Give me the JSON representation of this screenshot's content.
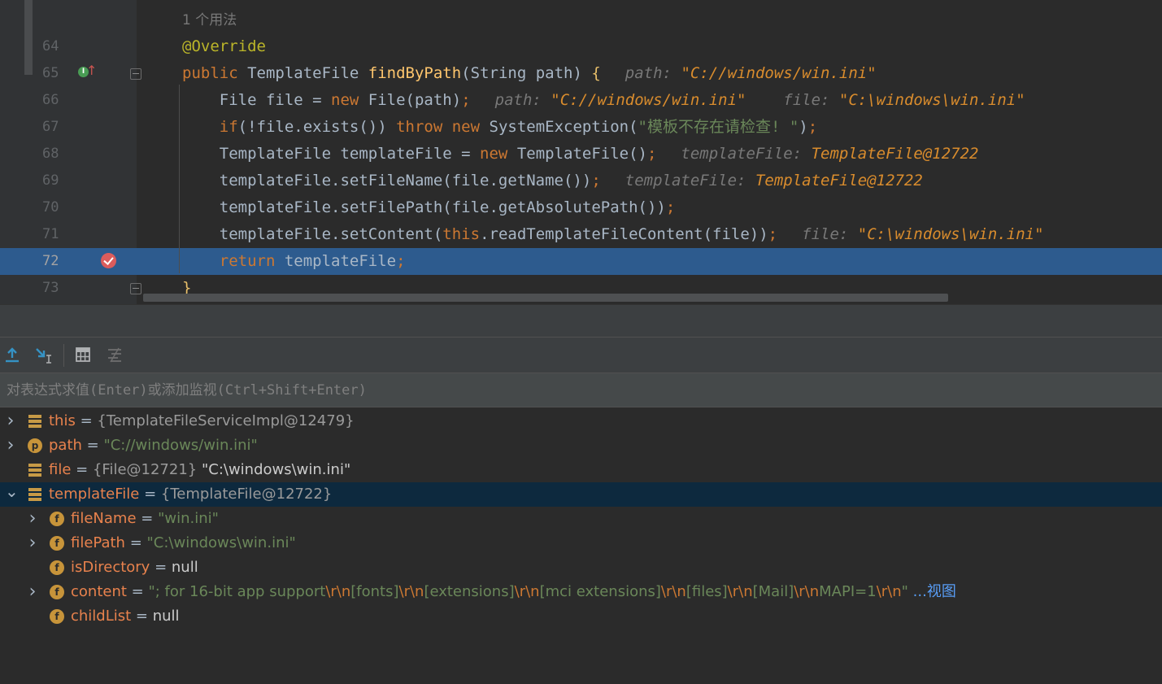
{
  "editor": {
    "usage_hint": "1 个用法",
    "lines": [
      {
        "num": "64",
        "parts": [
          {
            "t": "@Override",
            "c": "ann"
          }
        ]
      },
      {
        "num": "65",
        "parts": [
          {
            "t": "public ",
            "c": "kw"
          },
          {
            "t": "TemplateFile "
          },
          {
            "t": "findByPath",
            "c": "fn"
          },
          {
            "t": "(String path) "
          },
          {
            "t": "{",
            "c": "brk"
          }
        ],
        "hint": [
          {
            "t": "path: ",
            "c": "hint"
          },
          {
            "t": "\"C://windows/win.ini\"",
            "c": "hintv"
          }
        ]
      },
      {
        "num": "66",
        "parts": [
          {
            "t": "    File file = "
          },
          {
            "t": "new ",
            "c": "kw"
          },
          {
            "t": "File(path)"
          },
          {
            "t": ";",
            "c": "kw"
          }
        ],
        "hint": [
          {
            "t": "path: ",
            "c": "hint"
          },
          {
            "t": "\"C://windows/win.ini\"",
            "c": "hintv"
          },
          {
            "t": "    file: ",
            "c": "hint2"
          },
          {
            "t": "\"C:\\windows\\win.ini\"",
            "c": "hintv"
          }
        ]
      },
      {
        "num": "67",
        "parts": [
          {
            "t": "    if",
            "c": "kw"
          },
          {
            "t": "(!file.exists()) "
          },
          {
            "t": "throw new ",
            "c": "kw"
          },
          {
            "t": "SystemException("
          },
          {
            "t": "\"模板不存在请检查! \"",
            "c": "str"
          },
          {
            "t": ")"
          },
          {
            "t": ";",
            "c": "kw"
          }
        ]
      },
      {
        "num": "68",
        "parts": [
          {
            "t": "    TemplateFile templateFile = "
          },
          {
            "t": "new ",
            "c": "kw"
          },
          {
            "t": "TemplateFile()"
          },
          {
            "t": ";",
            "c": "kw"
          }
        ],
        "hint": [
          {
            "t": "templateFile: ",
            "c": "hint"
          },
          {
            "t": "TemplateFile@12722",
            "c": "hintv"
          }
        ]
      },
      {
        "num": "69",
        "parts": [
          {
            "t": "    templateFile.setFileName(file.getName())"
          },
          {
            "t": ";",
            "c": "kw"
          }
        ],
        "hint": [
          {
            "t": "templateFile: ",
            "c": "hint"
          },
          {
            "t": "TemplateFile@12722",
            "c": "hintv"
          }
        ]
      },
      {
        "num": "70",
        "parts": [
          {
            "t": "    templateFile.setFilePath(file.getAbsolutePath())"
          },
          {
            "t": ";",
            "c": "kw"
          }
        ]
      },
      {
        "num": "71",
        "parts": [
          {
            "t": "    templateFile.setContent("
          },
          {
            "t": "this",
            "c": "kw"
          },
          {
            "t": ".readTemplateFileContent(file))"
          },
          {
            "t": ";",
            "c": "kw"
          }
        ],
        "hint": [
          {
            "t": "file: ",
            "c": "hint"
          },
          {
            "t": "\"C:\\windows\\win.ini\"",
            "c": "hintv"
          }
        ]
      },
      {
        "num": "72",
        "parts": [
          {
            "t": "    return ",
            "c": "kw"
          },
          {
            "t": "templateFile"
          },
          {
            "t": ";",
            "c": "kw"
          }
        ],
        "highlight": true
      },
      {
        "num": "73",
        "parts": [
          {
            "t": "}",
            "c": "brk"
          }
        ]
      }
    ]
  },
  "toolbar": {
    "icons": [
      "step-out-icon",
      "run-to-cursor-icon",
      "evaluate-expression-icon",
      "trace-icon"
    ]
  },
  "eval": {
    "placeholder": "对表达式求值(Enter)或添加监视(Ctrl+Shift+Enter)"
  },
  "variables": [
    {
      "name": "this",
      "eq": " = ",
      "parts": [
        {
          "t": "{TemplateFileServiceImpl@12479}",
          "c": "vtype"
        }
      ],
      "icon": "stack",
      "expand": "collapsed",
      "indent": 0
    },
    {
      "name": "path",
      "eq": " = ",
      "parts": [
        {
          "t": "\"C://windows/win.ini\"",
          "c": "vstr"
        }
      ],
      "icon": "p",
      "expand": "collapsed",
      "indent": 0
    },
    {
      "name": "file",
      "eq": " = ",
      "parts": [
        {
          "t": "{File@12721} ",
          "c": "vtype"
        },
        {
          "t": "\"C:\\windows\\win.ini\"",
          "c": "vnull"
        }
      ],
      "icon": "stack",
      "expand": "none",
      "indent": 0
    },
    {
      "name": "templateFile",
      "eq": " = ",
      "parts": [
        {
          "t": "{TemplateFile@12722}",
          "c": "vtype"
        }
      ],
      "icon": "stack",
      "expand": "expanded",
      "indent": 0,
      "selected": true
    },
    {
      "name": "fileName",
      "eq": " = ",
      "parts": [
        {
          "t": "\"win.ini\"",
          "c": "vstr"
        }
      ],
      "icon": "f",
      "expand": "collapsed",
      "indent": 1
    },
    {
      "name": "filePath",
      "eq": " = ",
      "parts": [
        {
          "t": "\"C:\\windows\\win.ini\"",
          "c": "vstr"
        }
      ],
      "icon": "f",
      "expand": "collapsed",
      "indent": 1
    },
    {
      "name": "isDirectory",
      "eq": " = ",
      "parts": [
        {
          "t": "null",
          "c": "vnull"
        }
      ],
      "icon": "f",
      "expand": "none",
      "indent": 1
    },
    {
      "name": "content",
      "eq": " = ",
      "parts": [
        {
          "t": "\"; for 16-bit app support",
          "c": "vstr"
        },
        {
          "t": "\\r\\n",
          "c": "vesc"
        },
        {
          "t": "[fonts]",
          "c": "vstr"
        },
        {
          "t": "\\r\\n",
          "c": "vesc"
        },
        {
          "t": "[extensions]",
          "c": "vstr"
        },
        {
          "t": "\\r\\n",
          "c": "vesc"
        },
        {
          "t": "[mci extensions]",
          "c": "vstr"
        },
        {
          "t": "\\r\\n",
          "c": "vesc"
        },
        {
          "t": "[files]",
          "c": "vstr"
        },
        {
          "t": "\\r\\n",
          "c": "vesc"
        },
        {
          "t": "[Mail]",
          "c": "vstr"
        },
        {
          "t": "\\r\\n",
          "c": "vesc"
        },
        {
          "t": "MAPI=1",
          "c": "vstr"
        },
        {
          "t": "\\r\\n",
          "c": "vesc"
        },
        {
          "t": "\" ",
          "c": "vstr"
        },
        {
          "t": "...视图",
          "c": "vlink"
        }
      ],
      "icon": "f",
      "expand": "collapsed",
      "indent": 1
    },
    {
      "name": "childList",
      "eq": " = ",
      "parts": [
        {
          "t": "null",
          "c": "vnull"
        }
      ],
      "icon": "f",
      "expand": "none",
      "indent": 1
    }
  ],
  "icon_letters": {
    "p": "p",
    "f": "f",
    "override": "I"
  },
  "colors": {
    "highlight": "#2d5b8e",
    "selected_row": "#0d293e",
    "breakpoint": "#db5c5c"
  }
}
